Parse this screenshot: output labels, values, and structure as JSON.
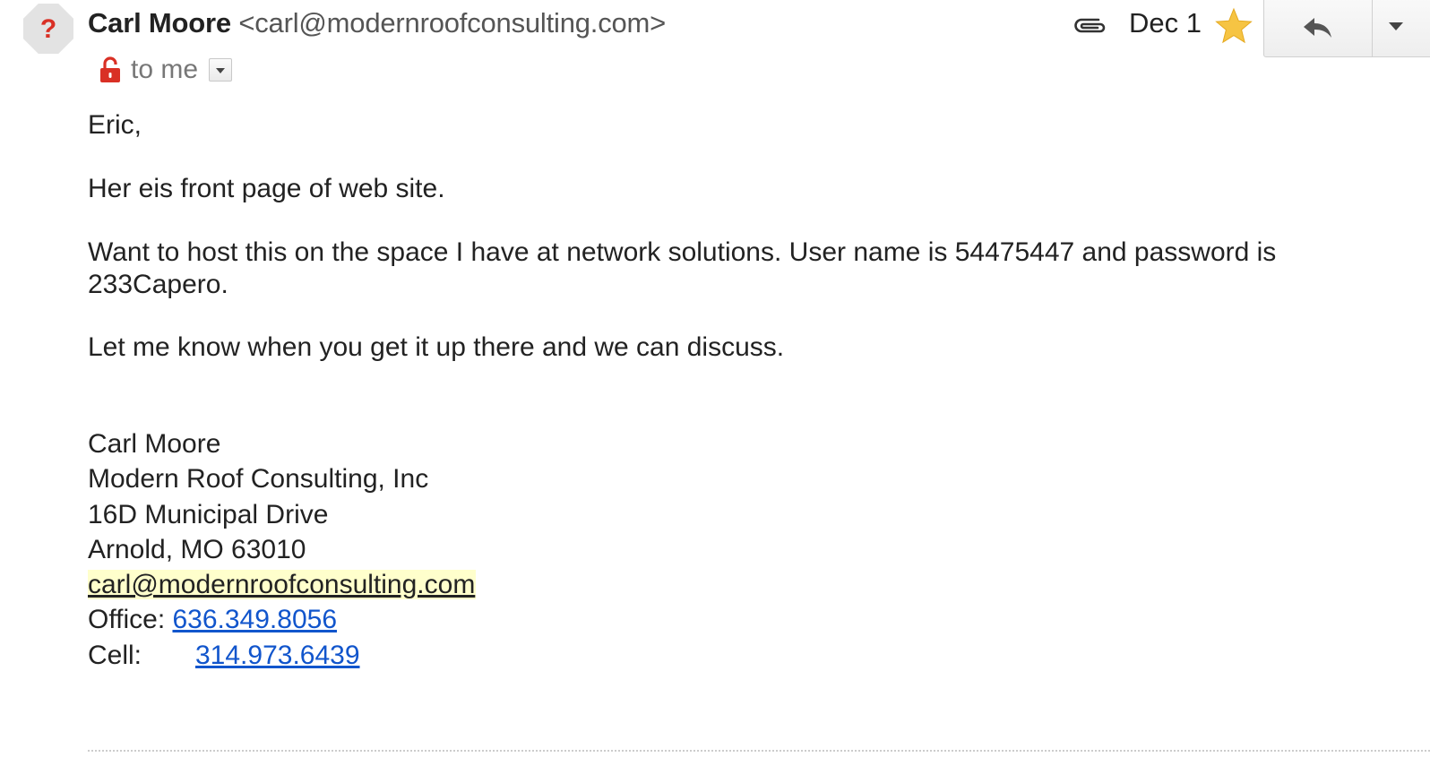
{
  "sender": {
    "avatar_glyph": "?",
    "name": "Carl Moore",
    "email": "<carl@modernroofconsulting.com>"
  },
  "recipient": {
    "to_label": "to me"
  },
  "meta": {
    "date": "Dec 1",
    "starred": true
  },
  "message": {
    "greeting": "Eric,",
    "paragraph_1": "Her eis front page of web site.",
    "paragraph_2": "Want to host this on the space I have at network solutions.  User name is 54475447 and password is 233Capero.",
    "paragraph_3": "Let me know when you get it up there and we can discuss."
  },
  "signature": {
    "name": "Carl Moore",
    "company": "Modern Roof Consulting, Inc",
    "street": "16D Municipal Drive",
    "city": "Arnold, MO 63010",
    "email": "carl@modernroofconsulting.com",
    "office_label": "Office: ",
    "office_phone": "636.349.8056",
    "cell_label": "Cell:",
    "cell_phone": "314.973.6439"
  },
  "icons": {
    "avatar": "unknown-sender-icon",
    "lock": "unlocked-padlock-icon",
    "attachment": "paperclip-icon",
    "star": "star-icon",
    "reply": "reply-arrow-icon",
    "more": "chevron-down-icon"
  },
  "colors": {
    "link": "#1155cc",
    "star": "#f6c443",
    "lock": "#d93025",
    "highlight": "#ffffcc"
  }
}
